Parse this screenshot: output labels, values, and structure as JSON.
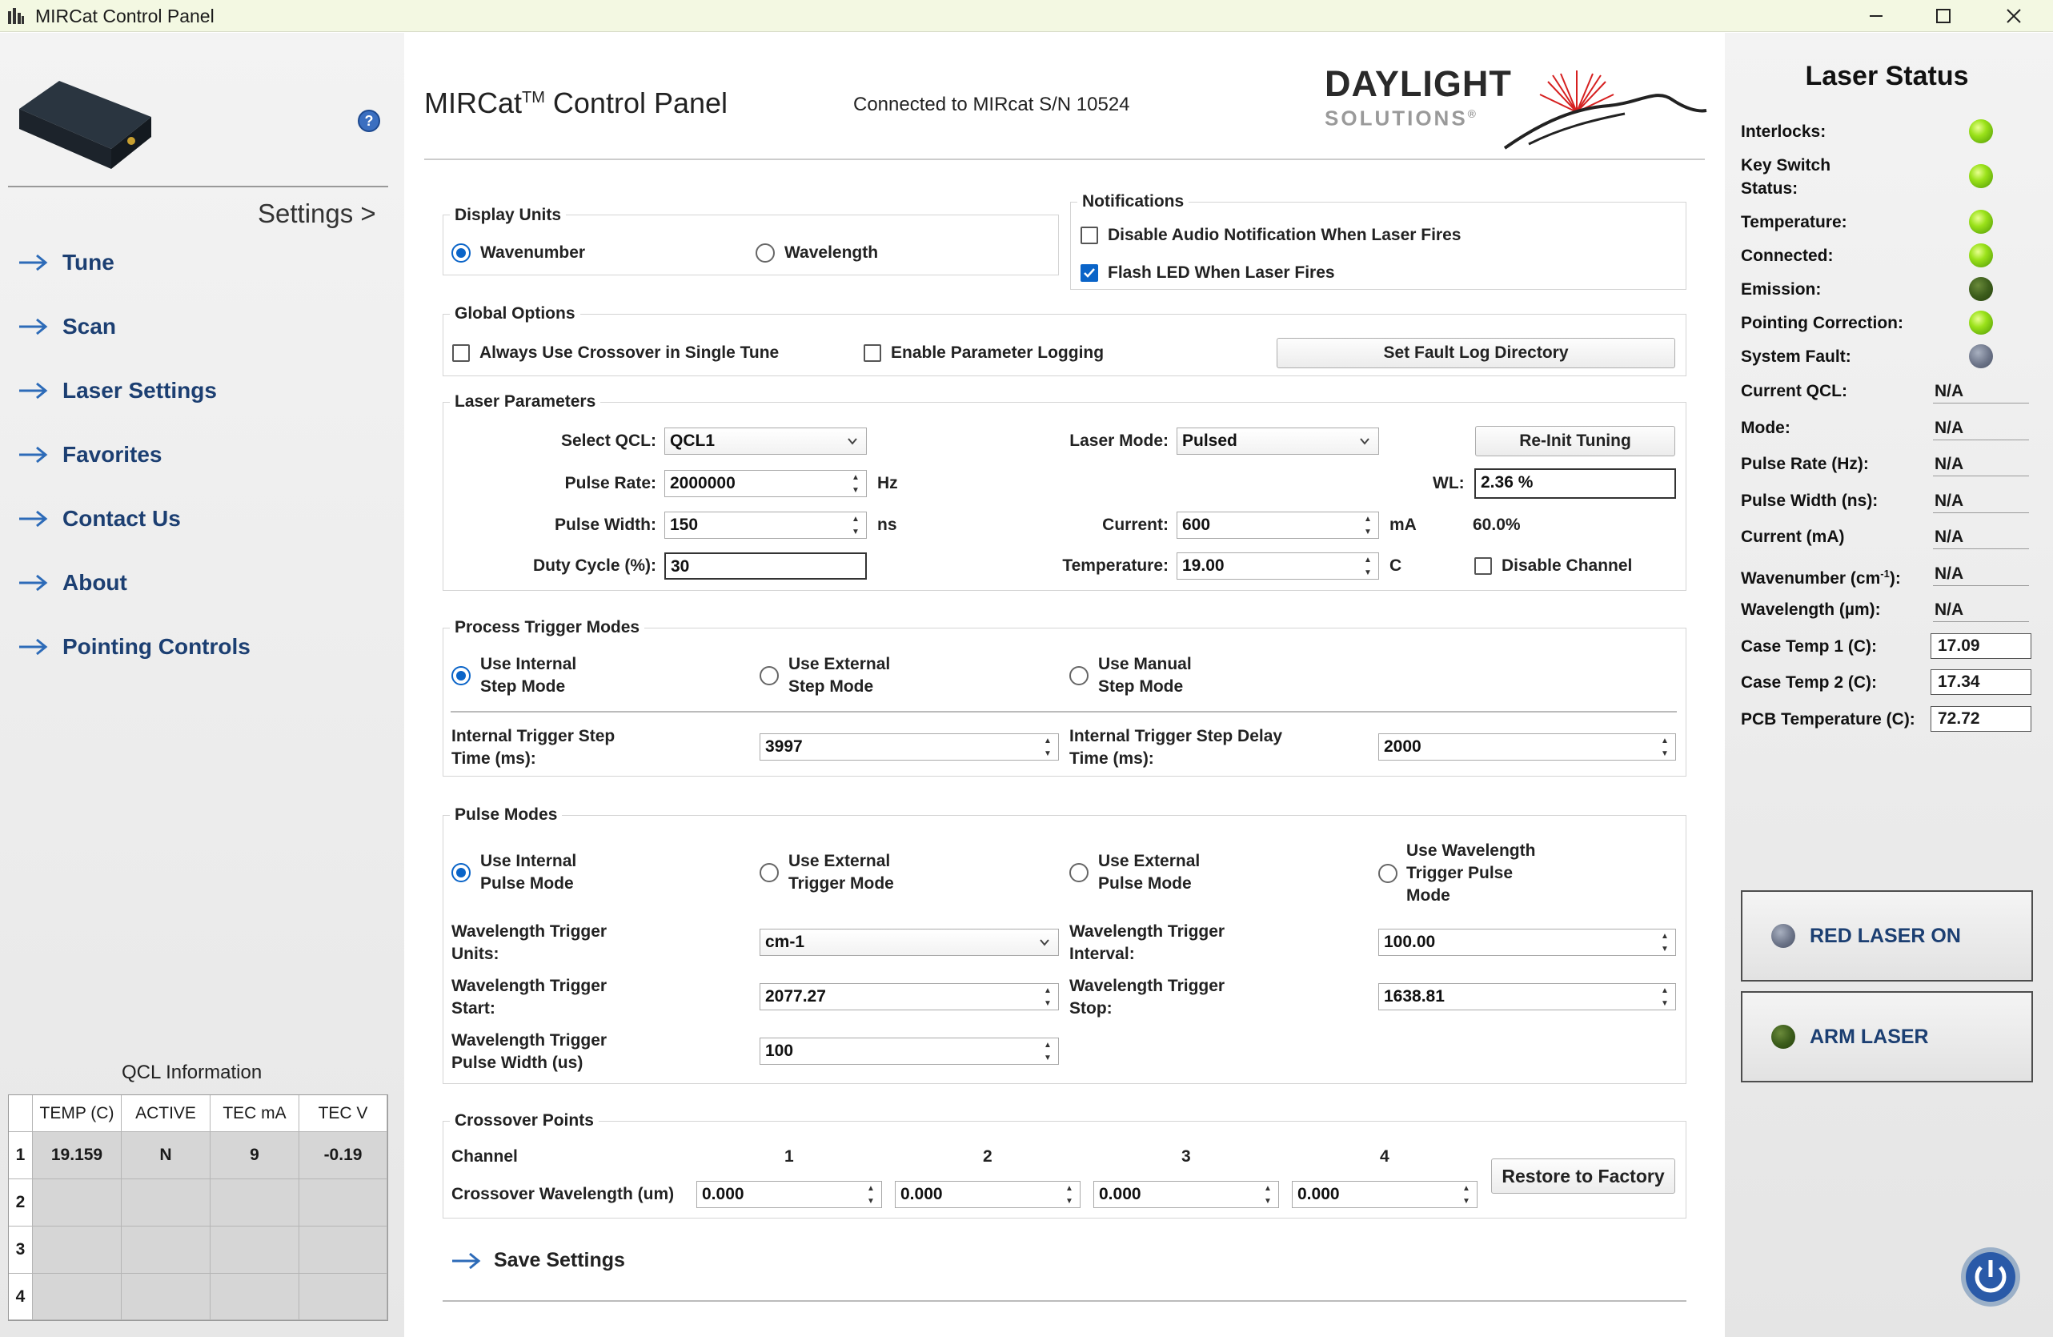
{
  "window": {
    "title": "MIRCat Control Panel"
  },
  "header": {
    "title_main": "MIRCat",
    "title_sup": "TM",
    "title_rest": " Control Panel",
    "connection": "Connected to MIRcat S/N 10524",
    "logo_line1": "DAYLIGHT",
    "logo_line2": "SOLUTIONS",
    "logo_reg": "®"
  },
  "sidebar": {
    "settings_label": "Settings >",
    "nav": [
      {
        "label": "Tune"
      },
      {
        "label": "Scan"
      },
      {
        "label": "Laser Settings"
      },
      {
        "label": "Favorites"
      },
      {
        "label": "Contact Us"
      },
      {
        "label": "About"
      },
      {
        "label": "Pointing Controls"
      }
    ],
    "qcl_info": {
      "title": "QCL Information",
      "columns": [
        "TEMP (C)",
        "ACTIVE",
        "TEC mA",
        "TEC V"
      ],
      "rows": [
        {
          "idx": "1",
          "cells": [
            "19.159",
            "N",
            "9",
            "-0.19"
          ]
        },
        {
          "idx": "2",
          "cells": [
            "",
            "",
            "",
            ""
          ]
        },
        {
          "idx": "3",
          "cells": [
            "",
            "",
            "",
            ""
          ]
        },
        {
          "idx": "4",
          "cells": [
            "",
            "",
            "",
            ""
          ]
        }
      ]
    }
  },
  "display_units": {
    "label": "Display Units",
    "wavenumber": "Wavenumber",
    "wavelength": "Wavelength",
    "selected": "Wavenumber"
  },
  "notifications": {
    "label": "Notifications",
    "disable_audio": "Disable Audio Notification When Laser Fires",
    "disable_audio_checked": false,
    "flash_led": "Flash LED When Laser Fires",
    "flash_led_checked": true
  },
  "global_options": {
    "label": "Global Options",
    "crossover": "Always Use Crossover in Single Tune",
    "logging": "Enable Parameter Logging",
    "fault_dir_btn": "Set Fault Log Directory"
  },
  "laser_params": {
    "label": "Laser Parameters",
    "select_qcl_label": "Select QCL:",
    "select_qcl_value": "QCL1",
    "pulse_rate_label": "Pulse Rate:",
    "pulse_rate_value": "2000000",
    "pulse_rate_unit": "Hz",
    "pulse_width_label": "Pulse Width:",
    "pulse_width_value": "150",
    "pulse_width_unit": "ns",
    "duty_cycle_label": "Duty Cycle (%):",
    "duty_cycle_value": "30",
    "laser_mode_label": "Laser Mode:",
    "laser_mode_value": "Pulsed",
    "current_label": "Current:",
    "current_value": "600",
    "current_unit": "mA",
    "current_pct": "60.0%",
    "temperature_label": "Temperature:",
    "temperature_value": "19.00",
    "temperature_unit": "C",
    "reinit_btn": "Re-Init Tuning",
    "wl_label": "WL:",
    "wl_value": "2.36 %",
    "disable_channel": "Disable Channel"
  },
  "process_trigger": {
    "label": "Process Trigger Modes",
    "opt1_l1": "Use Internal",
    "opt1_l2": "Step Mode",
    "opt2_l1": "Use External",
    "opt2_l2": "Step Mode",
    "opt3_l1": "Use Manual",
    "opt3_l2": "Step Mode",
    "step_time_l1": "Internal Trigger Step",
    "step_time_l2": "Time (ms):",
    "step_time_value": "3997",
    "step_delay_l1": "Internal Trigger Step Delay",
    "step_delay_l2": "Time (ms):",
    "step_delay_value": "2000"
  },
  "pulse_modes": {
    "label": "Pulse Modes",
    "opt1_l1": "Use Internal",
    "opt1_l2": "Pulse Mode",
    "opt2_l1": "Use External",
    "opt2_l2": "Trigger Mode",
    "opt3_l1": "Use External",
    "opt3_l2": "Pulse Mode",
    "opt4_l1": "Use Wavelength",
    "opt4_l2": "Trigger Pulse",
    "opt4_l3": "Mode",
    "units_l1": "Wavelength Trigger",
    "units_l2": "Units:",
    "units_value": "cm-1",
    "interval_l1": "Wavelength Trigger",
    "interval_l2": "Interval:",
    "interval_value": "100.00",
    "start_l1": "Wavelength Trigger",
    "start_l2": "Start:",
    "start_value": "2077.27",
    "stop_l1": "Wavelength Trigger",
    "stop_l2": "Stop:",
    "stop_value": "1638.81",
    "pw_l1": "Wavelength Trigger",
    "pw_l2": "Pulse Width (us)",
    "pw_value": "100"
  },
  "crossover": {
    "label": "Crossover Points",
    "channel_label": "Channel",
    "channels": [
      "1",
      "2",
      "3",
      "4"
    ],
    "wavelength_label": "Crossover Wavelength (um)",
    "values": [
      "0.000",
      "0.000",
      "0.000",
      "0.000"
    ],
    "restore_btn": "Restore to Factory"
  },
  "save_settings": "Save Settings",
  "laser_status": {
    "title": "Laser Status",
    "interlocks": "Interlocks:",
    "key_switch_l1": "Key Switch",
    "key_switch_l2": "Status:",
    "temperature": "Temperature:",
    "connected": "Connected:",
    "emission": "Emission:",
    "pointing": "Pointing Correction:",
    "system_fault": "System Fault:",
    "current_qcl": "Current QCL:",
    "current_qcl_val": "N/A",
    "mode": "Mode:",
    "mode_val": "N/A",
    "pulse_rate": "Pulse Rate (Hz):",
    "pulse_rate_val": "N/A",
    "pulse_width": "Pulse Width (ns):",
    "pulse_width_val": "N/A",
    "current": "Current (mA)",
    "current_val": "N/A",
    "wavenumber": "Wavenumber (cm",
    "wavenumber_sup": "-1",
    "wavenumber_end": "):",
    "wavenumber_val": "N/A",
    "wavelength": "Wavelength (µm):",
    "wavelength_val": "N/A",
    "case1": "Case Temp 1 (C):",
    "case1_val": "17.09",
    "case2": "Case Temp 2 (C):",
    "case2_val": "17.34",
    "pcb": "PCB Temperature (C):",
    "pcb_val": "72.72",
    "red_laser_btn": "RED LASER ON",
    "arm_laser_btn": "ARM LASER"
  },
  "colors": {
    "accent": "#0a64c8",
    "nav": "#1c3f72",
    "led_green": "#7ccd16",
    "led_dark": "#3d5e1c",
    "led_gray": "#6c7488"
  }
}
